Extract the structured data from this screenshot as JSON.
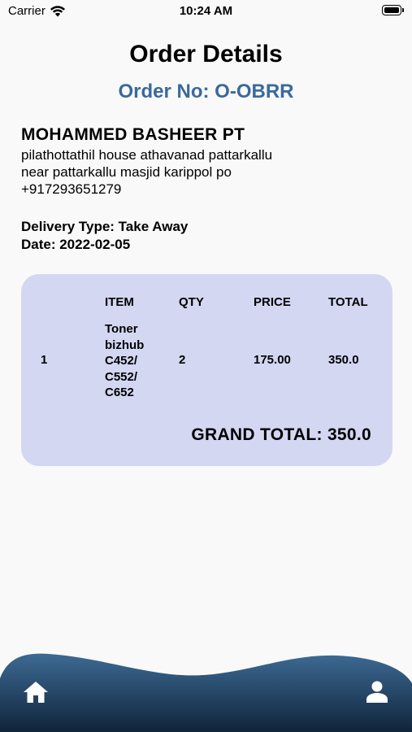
{
  "status_bar": {
    "carrier": "Carrier",
    "time": "10:24 AM",
    "battery_level": 1.0
  },
  "header": {
    "title": "Order Details",
    "order_no": "Order No: O-OBRR"
  },
  "customer": {
    "name": "MOHAMMED BASHEER PT",
    "address_line1": "pilathottathil house athavanad pattarkallu",
    "address_line2": "near pattarkallu masjid karippol po",
    "phone": "+917293651279"
  },
  "order_info": {
    "delivery_type": "Delivery Type: Take Away",
    "date": "Date: 2022-02-05"
  },
  "order_table": {
    "columns": [
      "ITEM",
      "QTY",
      "PRICE",
      "TOTAL"
    ],
    "rows": [
      {
        "index": "1",
        "item_lines": [
          "Toner",
          "bizhub",
          "C452/",
          "C552/",
          "C652"
        ],
        "qty": "2",
        "price": "175.00",
        "total": "350.0"
      }
    ],
    "grand_total": "GRAND TOTAL: 350.0"
  },
  "colors": {
    "accent": "#3a6a9b",
    "card_background": "#d4d7f2",
    "nav_gradient_top": "#3d6a94",
    "nav_gradient_bottom": "#10243a"
  },
  "bottom_nav": {
    "items": [
      {
        "icon": "home-icon"
      },
      {
        "icon": "person-icon"
      }
    ]
  }
}
